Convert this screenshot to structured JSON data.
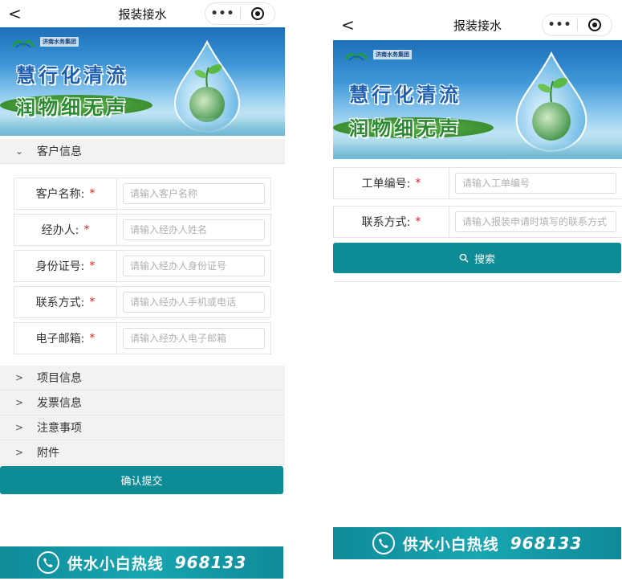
{
  "left": {
    "nav": {
      "back": "<",
      "title": "报装接水",
      "more": "•••"
    },
    "banner": {
      "logo_text": "济南水务集团",
      "slogan_line1": "慧行化清流",
      "slogan_line2": "润物细无声"
    },
    "section_customer": {
      "chevron": "⌄",
      "label": "客户信息"
    },
    "fields": [
      {
        "label": "客户名称:",
        "required": "*",
        "placeholder": "请输入客户名称",
        "value": ""
      },
      {
        "label": "经办人:",
        "required": "*",
        "placeholder": "请输入经办人姓名",
        "value": ""
      },
      {
        "label": "身份证号:",
        "required": "*",
        "placeholder": "请输入经办人身份证号",
        "value": ""
      },
      {
        "label": "联系方式:",
        "required": "*",
        "placeholder": "请输入经办人手机或电话",
        "value": ""
      },
      {
        "label": "电子邮箱:",
        "required": "*",
        "placeholder": "请输入经办人电子邮箱",
        "value": ""
      }
    ],
    "sections": [
      {
        "chevron": ">",
        "label": "项目信息"
      },
      {
        "chevron": ">",
        "label": "发票信息"
      },
      {
        "chevron": ">",
        "label": "注意事项"
      },
      {
        "chevron": ">",
        "label": "附件"
      }
    ],
    "submit_label": "确认提交",
    "hotline": {
      "text": "供水小白热线",
      "number": "968133"
    }
  },
  "right": {
    "nav": {
      "back": "<",
      "title": "报装接水",
      "more": "•••"
    },
    "banner": {
      "logo_text": "济南水务集团",
      "slogan_line1": "慧行化清流",
      "slogan_line2": "润物细无声"
    },
    "fields": [
      {
        "label": "工单编号:",
        "required": "*",
        "placeholder": "请输入工单编号",
        "value": ""
      },
      {
        "label": "联系方式:",
        "required": "*",
        "placeholder": "请输入报装申请时填写的联系方式",
        "value": ""
      }
    ],
    "search_label": "搜索",
    "hotline": {
      "text": "供水小白热线",
      "number": "968133"
    }
  },
  "colors": {
    "accent": "#0e8c96",
    "required": "#e02020",
    "section_bg": "#f2f2f2"
  },
  "icons": [
    "back-arrow-icon",
    "more-dots-icon",
    "target-close-icon",
    "chevron-down-icon",
    "chevron-right-icon",
    "search-icon",
    "phone-icon",
    "water-drop-icon",
    "logo-icon"
  ]
}
